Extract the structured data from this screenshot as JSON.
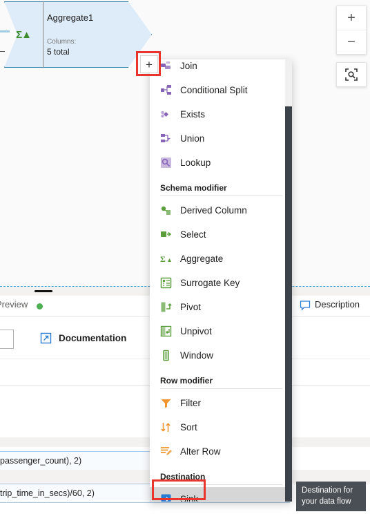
{
  "canvas": {
    "node": {
      "title": "Aggregate1",
      "columns_label": "Columns:",
      "columns_value": "5 total",
      "icon": "aggregate-sigma-icon",
      "glyph": "Σ▲"
    },
    "add_button_label": "+",
    "zoom_controls": {
      "zoom_in": "+",
      "zoom_out": "−",
      "fit_to_screen_icon": "fit-to-screen-icon"
    }
  },
  "menu": {
    "items": [
      {
        "label": "Join",
        "icon": "join-icon",
        "color": "#8764b8",
        "group": "multiple-inputs-outputs"
      },
      {
        "label": "Conditional Split",
        "icon": "conditional-split-icon",
        "color": "#8764b8",
        "group": "multiple-inputs-outputs"
      },
      {
        "label": "Exists",
        "icon": "exists-icon",
        "color": "#8764b8",
        "group": "multiple-inputs-outputs"
      },
      {
        "label": "Union",
        "icon": "union-icon",
        "color": "#8764b8",
        "group": "multiple-inputs-outputs"
      },
      {
        "label": "Lookup",
        "icon": "lookup-icon",
        "color": "#8764b8",
        "group": "multiple-inputs-outputs"
      }
    ],
    "schema_modifier_header": "Schema modifier",
    "schema_modifier_items": [
      {
        "label": "Derived Column",
        "icon": "derived-column-icon",
        "color": "#5a9e3a"
      },
      {
        "label": "Select",
        "icon": "select-icon",
        "color": "#5a9e3a"
      },
      {
        "label": "Aggregate",
        "icon": "aggregate-icon",
        "color": "#5a9e3a"
      },
      {
        "label": "Surrogate Key",
        "icon": "surrogate-key-icon",
        "color": "#5a9e3a"
      },
      {
        "label": "Pivot",
        "icon": "pivot-icon",
        "color": "#5a9e3a"
      },
      {
        "label": "Unpivot",
        "icon": "unpivot-icon",
        "color": "#5a9e3a"
      },
      {
        "label": "Window",
        "icon": "window-icon",
        "color": "#5a9e3a"
      }
    ],
    "row_modifier_header": "Row modifier",
    "row_modifier_items": [
      {
        "label": "Filter",
        "icon": "filter-icon",
        "color": "#f0962f"
      },
      {
        "label": "Sort",
        "icon": "sort-icon",
        "color": "#f0962f"
      },
      {
        "label": "Alter Row",
        "icon": "alter-row-icon",
        "color": "#f0962f"
      }
    ],
    "destination_header": "Destination",
    "destination_items": [
      {
        "label": "Sink",
        "icon": "sink-icon",
        "color": "#2b7cd3",
        "hovered": true
      }
    ]
  },
  "tooltip": {
    "text": "Destination for your data flow"
  },
  "panel": {
    "preview_tab": "Preview",
    "description_button": "Description",
    "description_icon": "comment-icon",
    "documentation_button": "Documentation",
    "documentation_icon": "external-link-icon",
    "expressions": [
      "passenger_count), 2)",
      "trip_time_in_secs)/60, 2)"
    ]
  },
  "colors": {
    "node_fill": "#deecf9",
    "node_border": "#2a7ea8",
    "annotation_red": "#e8352e",
    "status_green": "#4caf50",
    "tooltip_bg": "#4a4f55"
  }
}
